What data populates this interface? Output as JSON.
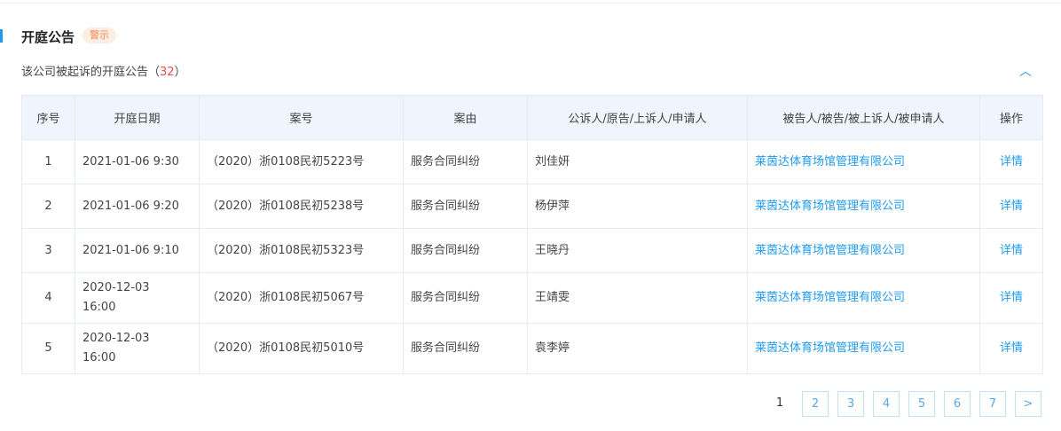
{
  "section": {
    "title": "开庭公告",
    "badge": "警示",
    "subtitle": "该公司被起诉的开庭公告（",
    "count": "32",
    "subtitle_end": "）",
    "collapse_icon": "chevron-up-icon"
  },
  "table": {
    "headers": [
      "序号",
      "开庭日期",
      "案号",
      "案由",
      "公诉人/原告/上诉人/申请人",
      "被告人/被告/被上诉人/被申请人",
      "操作"
    ],
    "rows": [
      {
        "no": "1",
        "date": "2021-01-06 9:30",
        "case": "（2020）浙0108民初5223号",
        "reason": "服务合同纠纷",
        "plaintiff": "刘佳妍",
        "defendant": "莱茵达体育场馆管理有限公司",
        "action": "详情"
      },
      {
        "no": "2",
        "date": "2021-01-06 9:20",
        "case": "（2020）浙0108民初5238号",
        "reason": "服务合同纠纷",
        "plaintiff": "杨伊萍",
        "defendant": "莱茵达体育场馆管理有限公司",
        "action": "详情"
      },
      {
        "no": "3",
        "date": "2021-01-06 9:10",
        "case": "（2020）浙0108民初5323号",
        "reason": "服务合同纠纷",
        "plaintiff": "王晓丹",
        "defendant": "莱茵达体育场馆管理有限公司",
        "action": "详情"
      },
      {
        "no": "4",
        "date": "2020-12-03 16:00",
        "case": "（2020）浙0108民初5067号",
        "reason": "服务合同纠纷",
        "plaintiff": "王靖雯",
        "defendant": "莱茵达体育场馆管理有限公司",
        "action": "详情"
      },
      {
        "no": "5",
        "date": "2020-12-03 16:00",
        "case": "（2020）浙0108民初5010号",
        "reason": "服务合同纠纷",
        "plaintiff": "袁李婷",
        "defendant": "莱茵达体育场馆管理有限公司",
        "action": "详情"
      }
    ]
  },
  "pagination": {
    "pages": [
      "1",
      "2",
      "3",
      "4",
      "5",
      "6",
      "7"
    ],
    "current": "1",
    "next": ">"
  }
}
